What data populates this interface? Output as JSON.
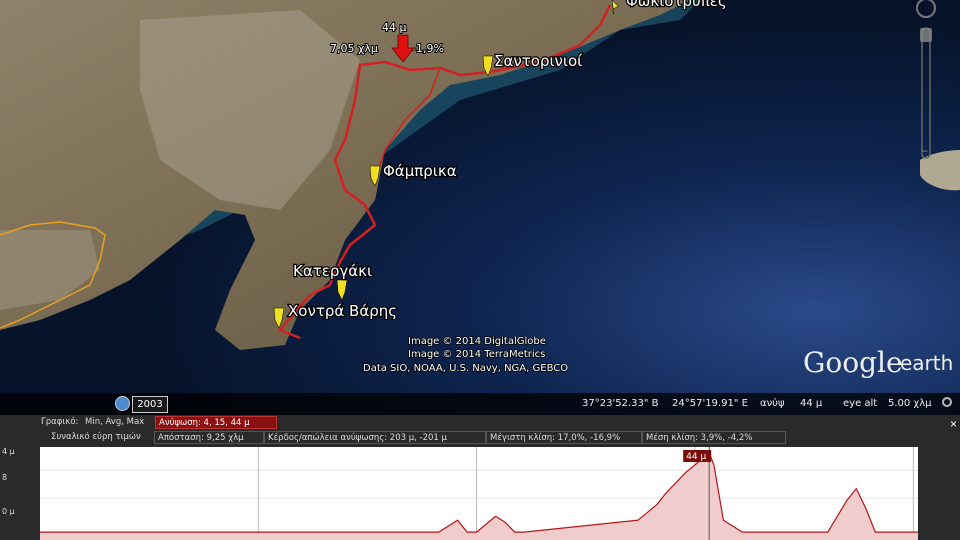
{
  "map": {
    "pins": [
      {
        "label": "Φωκιότρυπες"
      },
      {
        "label": "Σαντορινιοί"
      },
      {
        "label": "Φάμπρικα"
      },
      {
        "label": "Κατεργάκι"
      },
      {
        "label": "Χοντρά Βάρης"
      }
    ],
    "marker": {
      "elevation": "44 μ",
      "distance": "7,05 χλμ",
      "slope": "-1,9%"
    },
    "credits": [
      "Image © 2014 DigitalGlobe",
      "Image © 2014 TerraMetrics",
      "Data SIO, NOAA, U.S. Navy, NGA, GEBCO"
    ],
    "logo": {
      "google": "Google",
      "earth": "earth"
    },
    "colors": {
      "route": "#d42020",
      "sea_deep": "#0a1e3c",
      "land": "#8c7a5e",
      "boundary": "#e8a020",
      "pin": "#f0e020"
    }
  },
  "status": {
    "year": "2003",
    "lat": "37°23'52.33\" Β",
    "lon": "24°57'19.91\" Ε",
    "elev_label": "ανύψ",
    "elev_value": "44 μ",
    "eye_alt_label": "eye alt",
    "eye_alt_value": "5.00 χλμ"
  },
  "profile": {
    "row1": {
      "graph_label": "Γραφικό:",
      "stats_label": "Min, Avg, Max",
      "elevation_cell": "Ανύψωση: 4, 15, 44 μ"
    },
    "row2": {
      "range_label": "Συναλικό εύρη τιμών",
      "distance_cell": "Απόσταση: 9,25 χλμ",
      "gain_cell": "Κέρδος/απώλεια ανύψωσης: 203 μ, -201 μ",
      "max_slope_cell": "Μέγιστη κλίση: 17,0%, -16,9%",
      "avg_slope_cell": "Μέση κλίση: 3,9%, -4,2%"
    },
    "y_labels": [
      "4 μ",
      "8",
      "0 μ"
    ],
    "cursor_label": "44 μ",
    "close": "×"
  },
  "chart_data": {
    "type": "area",
    "title": "",
    "xlabel": "",
    "ylabel": "",
    "x_units": "χλμ",
    "y_units": "μ",
    "xlim": [
      0,
      9.25
    ],
    "ylim": [
      0,
      44
    ],
    "series": [
      {
        "x": [
          0,
          4.2,
          4.4,
          4.5,
          4.6,
          4.8,
          4.9,
          5.0,
          5.1,
          6.3,
          6.5,
          6.6,
          6.8,
          7.0,
          7.05,
          7.1,
          7.2,
          7.4,
          8.3,
          8.5,
          8.6,
          8.7,
          8.8,
          9.25
        ],
        "y": [
          4,
          4,
          10,
          4,
          4,
          12,
          9,
          4,
          4,
          10,
          18,
          24,
          34,
          42,
          44,
          38,
          10,
          4,
          4,
          20,
          26,
          16,
          4,
          4
        ]
      }
    ],
    "cursor": {
      "x": 7.05,
      "y": 44
    },
    "grid": true,
    "vertical_gridlines_x": [
      2.3,
      4.6,
      6.9,
      9.2
    ],
    "colors": {
      "fill": "#f1cccc",
      "line": "#b31717",
      "background": "#ffffff"
    }
  }
}
